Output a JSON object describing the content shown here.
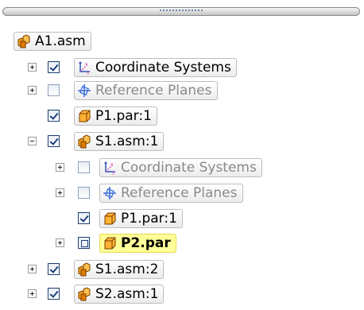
{
  "tree": {
    "root": {
      "label": "A1.asm",
      "icon": "assembly-icon"
    },
    "items": [
      {
        "label": "Coordinate Systems",
        "icon": "coordinate-systems-icon",
        "checked": true,
        "expander": "plus"
      },
      {
        "label": "Reference Planes",
        "icon": "reference-planes-icon",
        "checked": false,
        "expander": "plus"
      },
      {
        "label": "P1.par:1",
        "icon": "part-icon",
        "checked": true,
        "expander": "none"
      },
      {
        "label": "S1.asm:1",
        "icon": "assembly-icon",
        "checked": true,
        "expander": "minus"
      },
      {
        "label": "Coordinate Systems",
        "icon": "coordinate-systems-icon",
        "checked": false,
        "expander": "plus"
      },
      {
        "label": "Reference Planes",
        "icon": "reference-planes-icon",
        "checked": false,
        "expander": "plus"
      },
      {
        "label": "P1.par:1",
        "icon": "part-icon",
        "checked": true,
        "expander": "none"
      },
      {
        "label": "P2.par",
        "icon": "part-icon",
        "checked": "partial",
        "expander": "plus",
        "selected": true
      },
      {
        "label": "S1.asm:2",
        "icon": "assembly-icon",
        "checked": true,
        "expander": "plus"
      },
      {
        "label": "S2.asm:1",
        "icon": "assembly-icon",
        "checked": true,
        "expander": "plus"
      }
    ]
  },
  "colors": {
    "selected_bg": "#ffff99",
    "checkbox_border": "#1c3f72",
    "part_orange": "#ff9a00"
  }
}
